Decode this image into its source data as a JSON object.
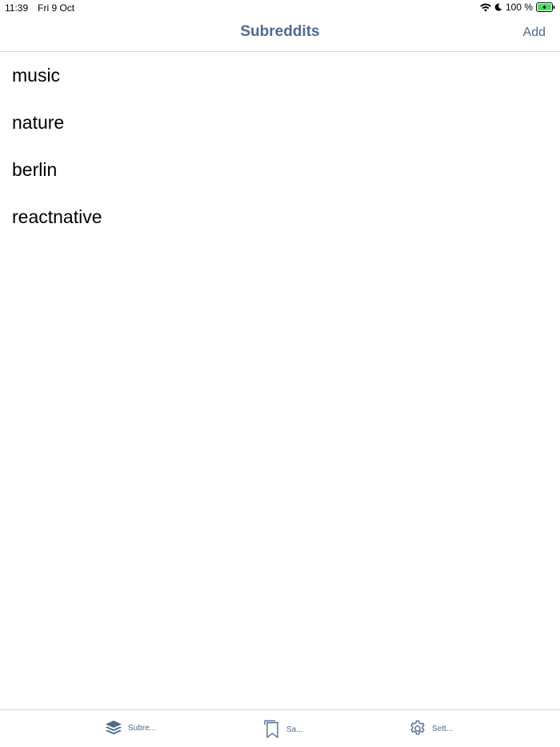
{
  "status_bar": {
    "time": "11:39",
    "date": "Fri 9 Oct",
    "battery": "100 %"
  },
  "nav": {
    "title": "Subreddits",
    "add_label": "Add"
  },
  "subreddits": [
    {
      "name": "music"
    },
    {
      "name": "nature"
    },
    {
      "name": "berlin"
    },
    {
      "name": "reactnative"
    }
  ],
  "tabs": [
    {
      "label": "Subre...",
      "icon": "layers-icon"
    },
    {
      "label": "Sa...",
      "icon": "bookmark-icon"
    },
    {
      "label": "Sett...",
      "icon": "gear-icon"
    }
  ],
  "colors": {
    "accent": "#4f6b8c",
    "divider": "#d6d6d6",
    "battery_green": "#4cd964"
  }
}
